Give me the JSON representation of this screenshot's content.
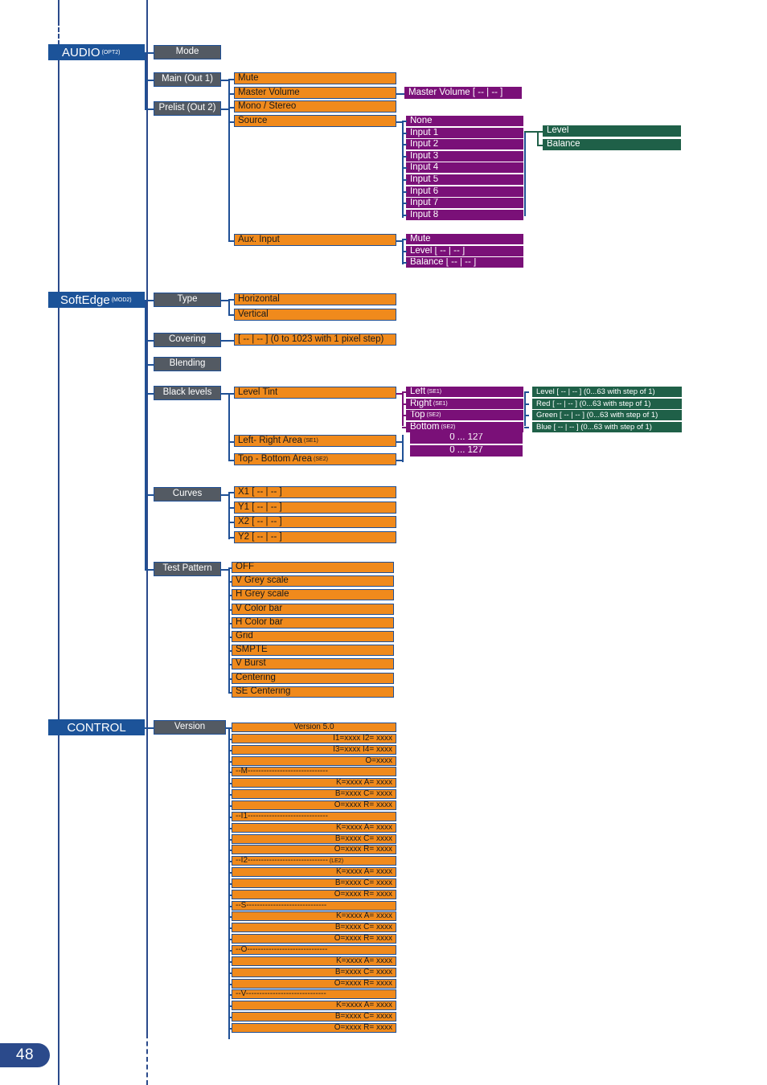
{
  "page": {
    "number": "48"
  },
  "colors": {
    "header_blue": "#1c5399",
    "grey": "#535a63",
    "orange": "#f08a1c",
    "purple": "#7a1078",
    "green": "#1f6048",
    "line_blue": "#1f5096"
  },
  "sections": {
    "audio": {
      "title": "AUDIO",
      "title_sup": "(OPT2)",
      "level2": [
        {
          "label": "Mode"
        },
        {
          "label": "Main (Out 1)"
        },
        {
          "label": "Prelist (Out 2)"
        }
      ],
      "level3": [
        {
          "label": "Mute"
        },
        {
          "label": "Master Volume"
        },
        {
          "label": "Mono / Stereo"
        },
        {
          "label": "Source"
        },
        {
          "label": "Aux. Input"
        }
      ],
      "master_volume_value": "Master Volume [ -- | -- ]",
      "sources": [
        "None",
        "Input 1",
        "Input 2",
        "Input 3",
        "Input 4",
        "Input 5",
        "Input 6",
        "Input 7",
        "Input 8"
      ],
      "source_params": [
        "Level",
        "Balance"
      ],
      "aux_input_params": [
        "Mute",
        "Level          [ -- | -- ]",
        "Balance      [ -- | -- ]"
      ]
    },
    "softedge": {
      "title": "SoftEdge",
      "title_sup": "(MOD2)",
      "level2": [
        {
          "label": "Type"
        },
        {
          "label": "Covering"
        },
        {
          "label": "Blending"
        },
        {
          "label": "Black levels"
        },
        {
          "label": "Curves"
        },
        {
          "label": "Test Pattern"
        }
      ],
      "type_options": [
        "Horizontal",
        "Vertical"
      ],
      "covering_value": "[ -- | -- ]    (0 to 1023 with 1 pixel step)",
      "black_levels": [
        {
          "label": "Level Tint",
          "sup": ""
        },
        {
          "label": "Left- Right Area",
          "sup": "(SE1)"
        },
        {
          "label": "Top - Bottom Area",
          "sup": "(SE2)"
        }
      ],
      "level_tint_edges": [
        {
          "label": "Left",
          "sup": "(SE1)"
        },
        {
          "label": "Right",
          "sup": "(SE1)"
        },
        {
          "label": "Top",
          "sup": "(SE2)"
        },
        {
          "label": "Bottom",
          "sup": "(SE2)"
        }
      ],
      "level_tint_values": [
        "Level [ -- | -- ] (0...63 with step of 1)",
        "Red [ -- | -- ] (0...63 with step of 1)",
        "Green [ -- | -- ] (0...63 with step of 1)",
        "Blue [ -- | -- ] (0...63 with step of 1)"
      ],
      "area_ranges": [
        "0 ... 127",
        "0 ... 127"
      ],
      "curves": [
        "X1          [ -- | -- ]",
        "Y1          [ -- | -- ]",
        "X2          [ -- | -- ]",
        "Y2          [ -- | -- ]"
      ],
      "test_patterns": [
        "OFF",
        "V Grey scale",
        "H Grey scale",
        "V Color bar",
        "H Color bar",
        "Grid",
        "SMPTE",
        "V Burst",
        "Centering",
        "SE Centering"
      ]
    },
    "control": {
      "title": "CONTROL",
      "title_sup": "",
      "level2": [
        {
          "label": "Version"
        }
      ],
      "version_lines": [
        {
          "text": "Version 5.0",
          "align": "center",
          "sup": ""
        },
        {
          "text": "I1=xxxx I2= xxxx",
          "align": "right",
          "sup": ""
        },
        {
          "text": "I3=xxxx I4= xxxx",
          "align": "right",
          "sup": ""
        },
        {
          "text": "O=xxxx",
          "align": "right",
          "sup": ""
        },
        {
          "text": "--M------------------------------",
          "align": "left",
          "sup": ""
        },
        {
          "text": "K=xxxx A= xxxx",
          "align": "right",
          "sup": ""
        },
        {
          "text": "B=xxxx C= xxxx",
          "align": "right",
          "sup": ""
        },
        {
          "text": "O=xxxx R= xxxx",
          "align": "right",
          "sup": ""
        },
        {
          "text": "--I1------------------------------",
          "align": "left",
          "sup": ""
        },
        {
          "text": "K=xxxx A= xxxx",
          "align": "right",
          "sup": ""
        },
        {
          "text": "B=xxxx C= xxxx",
          "align": "right",
          "sup": ""
        },
        {
          "text": "O=xxxx R= xxxx",
          "align": "right",
          "sup": ""
        },
        {
          "text": "--I2------------------------------",
          "align": "left",
          "sup": "(LE2)"
        },
        {
          "text": "K=xxxx A= xxxx",
          "align": "right",
          "sup": ""
        },
        {
          "text": "B=xxxx C= xxxx",
          "align": "right",
          "sup": ""
        },
        {
          "text": "O=xxxx R= xxxx",
          "align": "right",
          "sup": ""
        },
        {
          "text": "--S------------------------------",
          "align": "left",
          "sup": ""
        },
        {
          "text": "K=xxxx A= xxxx",
          "align": "right",
          "sup": ""
        },
        {
          "text": "B=xxxx C= xxxx",
          "align": "right",
          "sup": ""
        },
        {
          "text": "O=xxxx R= xxxx",
          "align": "right",
          "sup": ""
        },
        {
          "text": "--O------------------------------",
          "align": "left",
          "sup": ""
        },
        {
          "text": "K=xxxx A= xxxx",
          "align": "right",
          "sup": ""
        },
        {
          "text": "B=xxxx C= xxxx",
          "align": "right",
          "sup": ""
        },
        {
          "text": "O=xxxx R= xxxx",
          "align": "right",
          "sup": ""
        },
        {
          "text": "--V------------------------------",
          "align": "left",
          "sup": ""
        },
        {
          "text": "K=xxxx A= xxxx",
          "align": "right",
          "sup": ""
        },
        {
          "text": "B=xxxx C= xxxx",
          "align": "right",
          "sup": ""
        },
        {
          "text": "O=xxxx R= xxxx",
          "align": "right",
          "sup": ""
        }
      ]
    }
  }
}
